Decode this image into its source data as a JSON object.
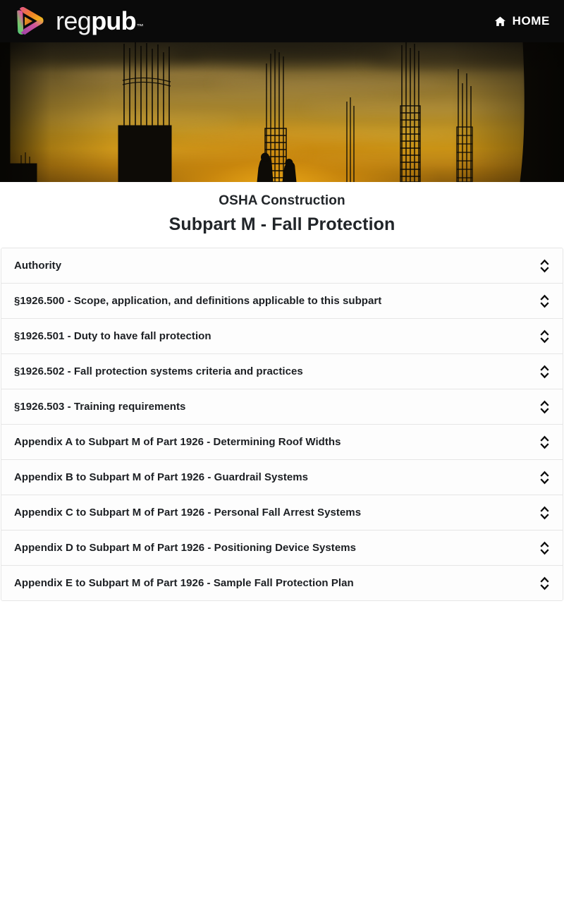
{
  "navbar": {
    "brand": {
      "icon": "regpub-play-triangle-logo",
      "word_light": "reg",
      "word_bold": "pub",
      "trademark": "™"
    },
    "home_link": {
      "icon": "home-icon",
      "label": "HOME"
    },
    "background_color": "#0a0a0a"
  },
  "hero": {
    "icon": "construction-site-sunset-photo",
    "alt": "Construction site rebar columns silhouetted against a golden sunset with two workers"
  },
  "page": {
    "supertitle": "OSHA Construction",
    "title": "Subpart M - Fall Protection"
  },
  "accordion": {
    "toggle_icon": "chevron-up-down-icon",
    "items": [
      {
        "label": "Authority"
      },
      {
        "label": "§1926.500 - Scope, application, and definitions applicable to this subpart"
      },
      {
        "label": "§1926.501 - Duty to have fall protection"
      },
      {
        "label": "§1926.502 - Fall protection systems criteria and practices"
      },
      {
        "label": "§1926.503 - Training requirements"
      },
      {
        "label": "Appendix A to Subpart M of Part 1926 - Determining Roof Widths"
      },
      {
        "label": "Appendix B to Subpart M of Part 1926 - Guardrail Systems"
      },
      {
        "label": "Appendix C to Subpart M of Part 1926 - Personal Fall Arrest Systems"
      },
      {
        "label": "Appendix D to Subpart M of Part 1926 - Positioning Device Systems"
      },
      {
        "label": "Appendix E to Subpart M of Part 1926 - Sample Fall Protection Plan"
      }
    ]
  },
  "colors": {
    "navbar_bg": "#0a0a0a",
    "text_dark": "#212529",
    "border": "#e6e6e6",
    "page_bg": "#ffffff",
    "logo_green": "#5bbf7a",
    "logo_pink": "#e2538f",
    "logo_orange": "#f07c2a",
    "logo_yellow": "#f2c417",
    "logo_purple": "#9b3fa8"
  }
}
